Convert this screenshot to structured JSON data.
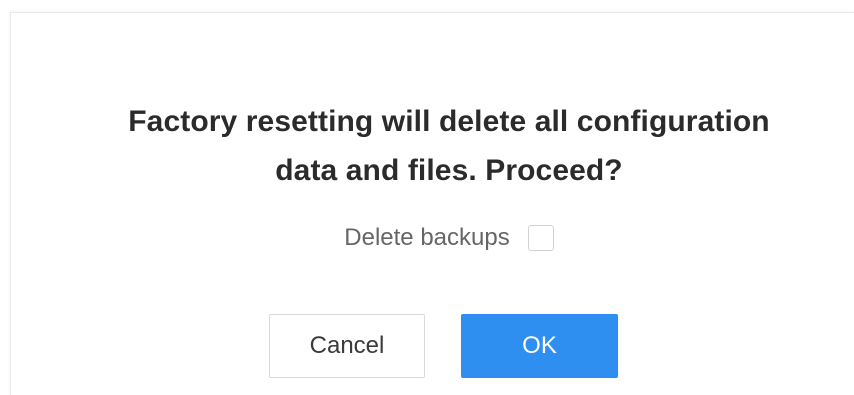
{
  "dialog": {
    "message_line1": "Factory resetting will delete all configuration",
    "message_line2": "data and files. Proceed?",
    "checkbox_label": "Delete backups",
    "checkbox_checked": false,
    "cancel_label": "Cancel",
    "ok_label": "OK"
  },
  "colors": {
    "primary": "#2f8ff0",
    "text": "#2b2b2b",
    "muted": "#666666"
  }
}
